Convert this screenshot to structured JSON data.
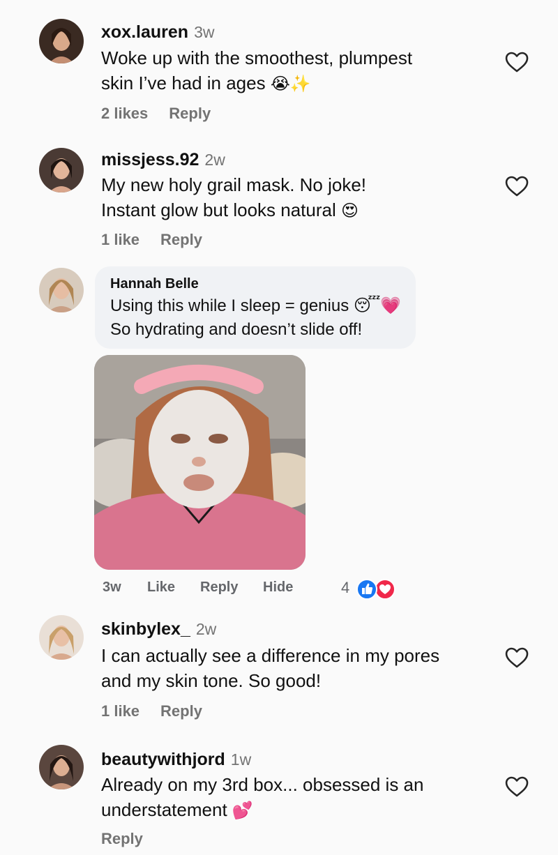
{
  "comments": [
    {
      "username": "xox.lauren",
      "time": "3w",
      "line1": "Woke up with the smoothest, plumpest",
      "line2": "skin I’ve had in ages",
      "emoji": "😭✨",
      "likes": "2 likes",
      "reply": "Reply"
    },
    {
      "username": "missjess.92",
      "time": "2w",
      "line1": "My new holy grail mask. No joke!",
      "line2": "Instant glow but looks natural",
      "emoji": "😍",
      "likes": "1 like",
      "reply": "Reply"
    },
    {
      "username": "skinbylex_",
      "time": "2w",
      "line1": "I can actually see a difference in my pores",
      "line2": "and my skin tone. So good!",
      "likes": "1 like",
      "reply": "Reply"
    },
    {
      "username": "beautywithjord",
      "time": "1w",
      "line1": "Already on my 3rd box... obsessed is an",
      "line2": "understatement",
      "emoji": "💕",
      "reply": "Reply"
    }
  ],
  "fb_comment": {
    "name": "Hannah Belle",
    "line1": "Using this while I sleep = genius",
    "line1_emoji": "😴💗",
    "line2": "So hydrating and doesn’t slide off!",
    "time": "3w",
    "like": "Like",
    "reply": "Reply",
    "hide": "Hide",
    "reaction_count": "4",
    "reactions": [
      "like-icon",
      "love-icon"
    ]
  },
  "colors": {
    "secondary_text": "#737373",
    "fb_like_blue": "#1877f2",
    "fb_love_red": "#f0284a",
    "bubble_bg": "#f0f2f5"
  }
}
